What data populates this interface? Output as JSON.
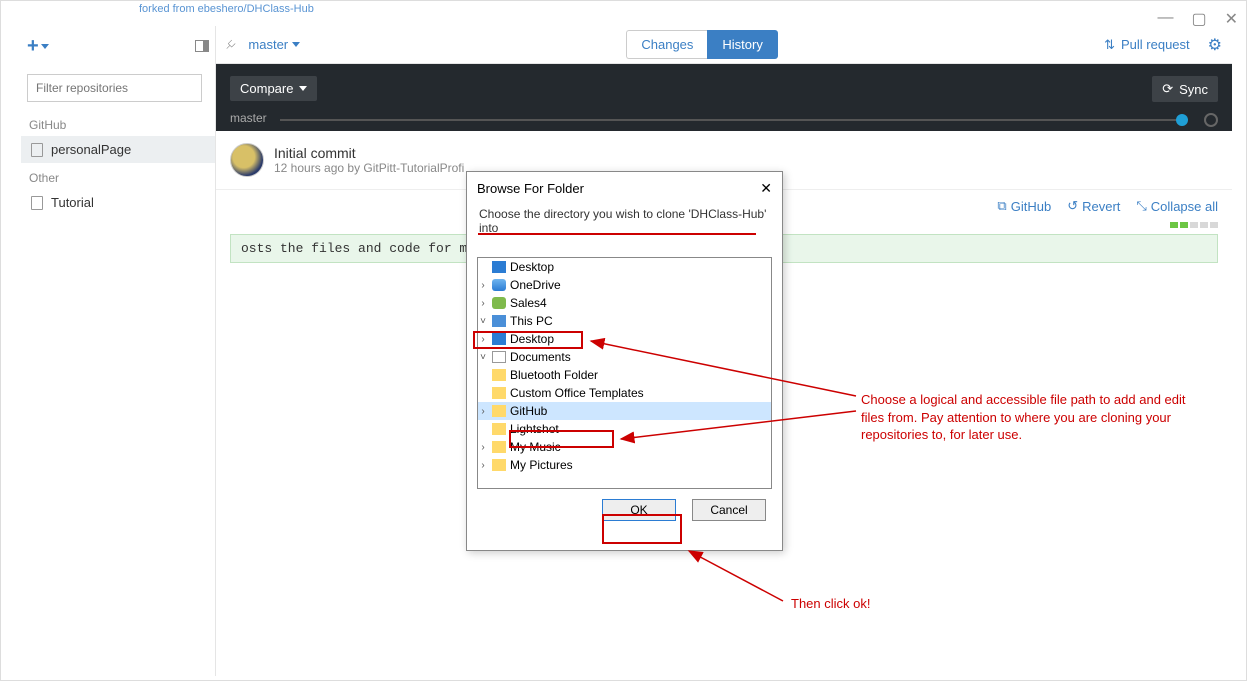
{
  "forked_text": "forked from ebeshero/DHClass-Hub",
  "sidebar": {
    "filter_placeholder": "Filter repositories",
    "sections": [
      {
        "label": "GitHub",
        "items": [
          {
            "name": "personalPage",
            "selected": true
          }
        ]
      },
      {
        "label": "Other",
        "items": [
          {
            "name": "Tutorial",
            "selected": false
          }
        ]
      }
    ]
  },
  "toolbar": {
    "branch": "master",
    "tabs": {
      "changes": "Changes",
      "history": "History"
    },
    "pull_request": "Pull request"
  },
  "dark_bar": {
    "compare": "Compare",
    "sync": "Sync",
    "branch": "master"
  },
  "commit": {
    "title": "Initial commit",
    "sub": "12 hours ago by GitPitt-TutorialProfi"
  },
  "actions": {
    "github": "GitHub",
    "revert": "Revert",
    "collapse": "Collapse all"
  },
  "diff_line": "osts the files and code for my personal webpage.",
  "dialog": {
    "title": "Browse For Folder",
    "message": "Choose the directory you wish to clone 'DHClass-Hub' into",
    "ok": "OK",
    "cancel": "Cancel",
    "tree": [
      {
        "depth": 0,
        "icon": "desktop",
        "label": "Desktop",
        "expand": ""
      },
      {
        "depth": 1,
        "icon": "cloud",
        "label": "OneDrive",
        "expand": "›"
      },
      {
        "depth": 1,
        "icon": "user",
        "label": "Sales4",
        "expand": "›"
      },
      {
        "depth": 1,
        "icon": "pc",
        "label": "This PC",
        "expand": "˅"
      },
      {
        "depth": 2,
        "icon": "desktop",
        "label": "Desktop",
        "expand": "›"
      },
      {
        "depth": 2,
        "icon": "doc",
        "label": "Documents",
        "expand": "˅"
      },
      {
        "depth": 3,
        "icon": "folder",
        "label": "Bluetooth Folder",
        "expand": ""
      },
      {
        "depth": 3,
        "icon": "folder",
        "label": "Custom Office Templates",
        "expand": ""
      },
      {
        "depth": 3,
        "icon": "folder",
        "label": "GitHub",
        "expand": "›",
        "selected": true
      },
      {
        "depth": 3,
        "icon": "folder",
        "label": "Lightshot",
        "expand": ""
      },
      {
        "depth": 3,
        "icon": "folder",
        "label": "My Music",
        "expand": "›"
      },
      {
        "depth": 3,
        "icon": "folder",
        "label": "My Pictures",
        "expand": "›"
      }
    ]
  },
  "annotations": {
    "a1": "Choose a logical and accessible file path to add and edit files from. Pay attention to where you are cloning your repositories to, for later use.",
    "a2": "Then click ok!"
  }
}
